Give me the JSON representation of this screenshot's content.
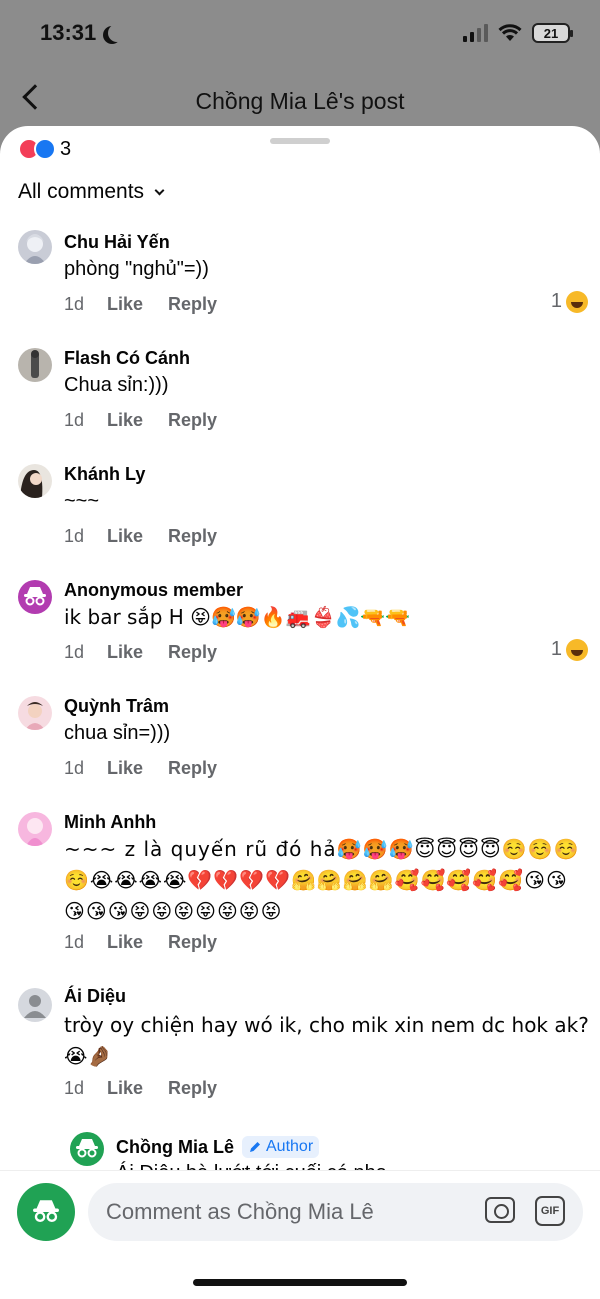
{
  "status": {
    "time": "13:31",
    "battery": "21"
  },
  "nav": {
    "title": "Chồng Mia Lê's post"
  },
  "sheet": {
    "reaction_count": "3",
    "filter_label": "All comments"
  },
  "comments": [
    {
      "name": "Chu Hải Yến",
      "text": "phòng \"nghủ\"=))",
      "time": "1d",
      "like": "Like",
      "reply": "Reply",
      "reaction_count": "1"
    },
    {
      "name": "Flash Có Cánh",
      "text": "Chua sỉn:)))",
      "time": "1d",
      "like": "Like",
      "reply": "Reply"
    },
    {
      "name": "Khánh Ly",
      "text": "~~~",
      "time": "1d",
      "like": "Like",
      "reply": "Reply"
    },
    {
      "name": "Anonymous member",
      "text": "ik bar sắp H 😝🥵🥵🔥🚒👙💦🔫🔫",
      "time": "1d",
      "like": "Like",
      "reply": "Reply",
      "reaction_count": "1"
    },
    {
      "name": "Quỳnh Trâm",
      "text": "chua sỉn=)))",
      "time": "1d",
      "like": "Like",
      "reply": "Reply"
    },
    {
      "name": "Minh Anhh",
      "text": "~~~ z là quyến rũ đó hả🥵🥵🥵😇😇😇😇☺️☺️☺️☺️😭😭😭😭💔💔💔💔🤗🤗🤗🤗🥰🥰🥰🥰🥰😘😘😘😘😘😝😝😝😝😝😝😝",
      "time": "1d",
      "like": "Like",
      "reply": "Reply"
    },
    {
      "name": "Ái Diệu",
      "text": "tròy oy chiện hay wó ik, cho mik xin nem dc hok ak?😭🤌🏾",
      "time": "1d",
      "like": "Like",
      "reply": "Reply"
    }
  ],
  "reply": {
    "name": "Chồng Mia Lê",
    "badge": "Author",
    "text": "Ái Diệu bà lướt tới cuối có nha"
  },
  "composer": {
    "placeholder": "Comment as Chồng Mia Lê",
    "gif": "GIF"
  }
}
